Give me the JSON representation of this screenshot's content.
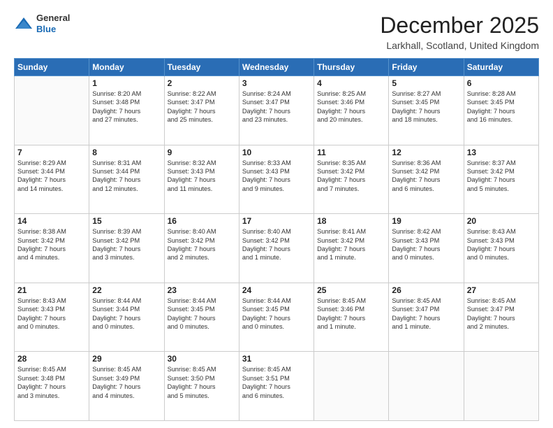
{
  "logo": {
    "general": "General",
    "blue": "Blue"
  },
  "header": {
    "month": "December 2025",
    "location": "Larkhall, Scotland, United Kingdom"
  },
  "days_of_week": [
    "Sunday",
    "Monday",
    "Tuesday",
    "Wednesday",
    "Thursday",
    "Friday",
    "Saturday"
  ],
  "weeks": [
    [
      {
        "day": "",
        "lines": []
      },
      {
        "day": "1",
        "lines": [
          "Sunrise: 8:20 AM",
          "Sunset: 3:48 PM",
          "Daylight: 7 hours",
          "and 27 minutes."
        ]
      },
      {
        "day": "2",
        "lines": [
          "Sunrise: 8:22 AM",
          "Sunset: 3:47 PM",
          "Daylight: 7 hours",
          "and 25 minutes."
        ]
      },
      {
        "day": "3",
        "lines": [
          "Sunrise: 8:24 AM",
          "Sunset: 3:47 PM",
          "Daylight: 7 hours",
          "and 23 minutes."
        ]
      },
      {
        "day": "4",
        "lines": [
          "Sunrise: 8:25 AM",
          "Sunset: 3:46 PM",
          "Daylight: 7 hours",
          "and 20 minutes."
        ]
      },
      {
        "day": "5",
        "lines": [
          "Sunrise: 8:27 AM",
          "Sunset: 3:45 PM",
          "Daylight: 7 hours",
          "and 18 minutes."
        ]
      },
      {
        "day": "6",
        "lines": [
          "Sunrise: 8:28 AM",
          "Sunset: 3:45 PM",
          "Daylight: 7 hours",
          "and 16 minutes."
        ]
      }
    ],
    [
      {
        "day": "7",
        "lines": [
          "Sunrise: 8:29 AM",
          "Sunset: 3:44 PM",
          "Daylight: 7 hours",
          "and 14 minutes."
        ]
      },
      {
        "day": "8",
        "lines": [
          "Sunrise: 8:31 AM",
          "Sunset: 3:44 PM",
          "Daylight: 7 hours",
          "and 12 minutes."
        ]
      },
      {
        "day": "9",
        "lines": [
          "Sunrise: 8:32 AM",
          "Sunset: 3:43 PM",
          "Daylight: 7 hours",
          "and 11 minutes."
        ]
      },
      {
        "day": "10",
        "lines": [
          "Sunrise: 8:33 AM",
          "Sunset: 3:43 PM",
          "Daylight: 7 hours",
          "and 9 minutes."
        ]
      },
      {
        "day": "11",
        "lines": [
          "Sunrise: 8:35 AM",
          "Sunset: 3:42 PM",
          "Daylight: 7 hours",
          "and 7 minutes."
        ]
      },
      {
        "day": "12",
        "lines": [
          "Sunrise: 8:36 AM",
          "Sunset: 3:42 PM",
          "Daylight: 7 hours",
          "and 6 minutes."
        ]
      },
      {
        "day": "13",
        "lines": [
          "Sunrise: 8:37 AM",
          "Sunset: 3:42 PM",
          "Daylight: 7 hours",
          "and 5 minutes."
        ]
      }
    ],
    [
      {
        "day": "14",
        "lines": [
          "Sunrise: 8:38 AM",
          "Sunset: 3:42 PM",
          "Daylight: 7 hours",
          "and 4 minutes."
        ]
      },
      {
        "day": "15",
        "lines": [
          "Sunrise: 8:39 AM",
          "Sunset: 3:42 PM",
          "Daylight: 7 hours",
          "and 3 minutes."
        ]
      },
      {
        "day": "16",
        "lines": [
          "Sunrise: 8:40 AM",
          "Sunset: 3:42 PM",
          "Daylight: 7 hours",
          "and 2 minutes."
        ]
      },
      {
        "day": "17",
        "lines": [
          "Sunrise: 8:40 AM",
          "Sunset: 3:42 PM",
          "Daylight: 7 hours",
          "and 1 minute."
        ]
      },
      {
        "day": "18",
        "lines": [
          "Sunrise: 8:41 AM",
          "Sunset: 3:42 PM",
          "Daylight: 7 hours",
          "and 1 minute."
        ]
      },
      {
        "day": "19",
        "lines": [
          "Sunrise: 8:42 AM",
          "Sunset: 3:43 PM",
          "Daylight: 7 hours",
          "and 0 minutes."
        ]
      },
      {
        "day": "20",
        "lines": [
          "Sunrise: 8:43 AM",
          "Sunset: 3:43 PM",
          "Daylight: 7 hours",
          "and 0 minutes."
        ]
      }
    ],
    [
      {
        "day": "21",
        "lines": [
          "Sunrise: 8:43 AM",
          "Sunset: 3:43 PM",
          "Daylight: 7 hours",
          "and 0 minutes."
        ]
      },
      {
        "day": "22",
        "lines": [
          "Sunrise: 8:44 AM",
          "Sunset: 3:44 PM",
          "Daylight: 7 hours",
          "and 0 minutes."
        ]
      },
      {
        "day": "23",
        "lines": [
          "Sunrise: 8:44 AM",
          "Sunset: 3:45 PM",
          "Daylight: 7 hours",
          "and 0 minutes."
        ]
      },
      {
        "day": "24",
        "lines": [
          "Sunrise: 8:44 AM",
          "Sunset: 3:45 PM",
          "Daylight: 7 hours",
          "and 0 minutes."
        ]
      },
      {
        "day": "25",
        "lines": [
          "Sunrise: 8:45 AM",
          "Sunset: 3:46 PM",
          "Daylight: 7 hours",
          "and 1 minute."
        ]
      },
      {
        "day": "26",
        "lines": [
          "Sunrise: 8:45 AM",
          "Sunset: 3:47 PM",
          "Daylight: 7 hours",
          "and 1 minute."
        ]
      },
      {
        "day": "27",
        "lines": [
          "Sunrise: 8:45 AM",
          "Sunset: 3:47 PM",
          "Daylight: 7 hours",
          "and 2 minutes."
        ]
      }
    ],
    [
      {
        "day": "28",
        "lines": [
          "Sunrise: 8:45 AM",
          "Sunset: 3:48 PM",
          "Daylight: 7 hours",
          "and 3 minutes."
        ]
      },
      {
        "day": "29",
        "lines": [
          "Sunrise: 8:45 AM",
          "Sunset: 3:49 PM",
          "Daylight: 7 hours",
          "and 4 minutes."
        ]
      },
      {
        "day": "30",
        "lines": [
          "Sunrise: 8:45 AM",
          "Sunset: 3:50 PM",
          "Daylight: 7 hours",
          "and 5 minutes."
        ]
      },
      {
        "day": "31",
        "lines": [
          "Sunrise: 8:45 AM",
          "Sunset: 3:51 PM",
          "Daylight: 7 hours",
          "and 6 minutes."
        ]
      },
      {
        "day": "",
        "lines": []
      },
      {
        "day": "",
        "lines": []
      },
      {
        "day": "",
        "lines": []
      }
    ]
  ]
}
